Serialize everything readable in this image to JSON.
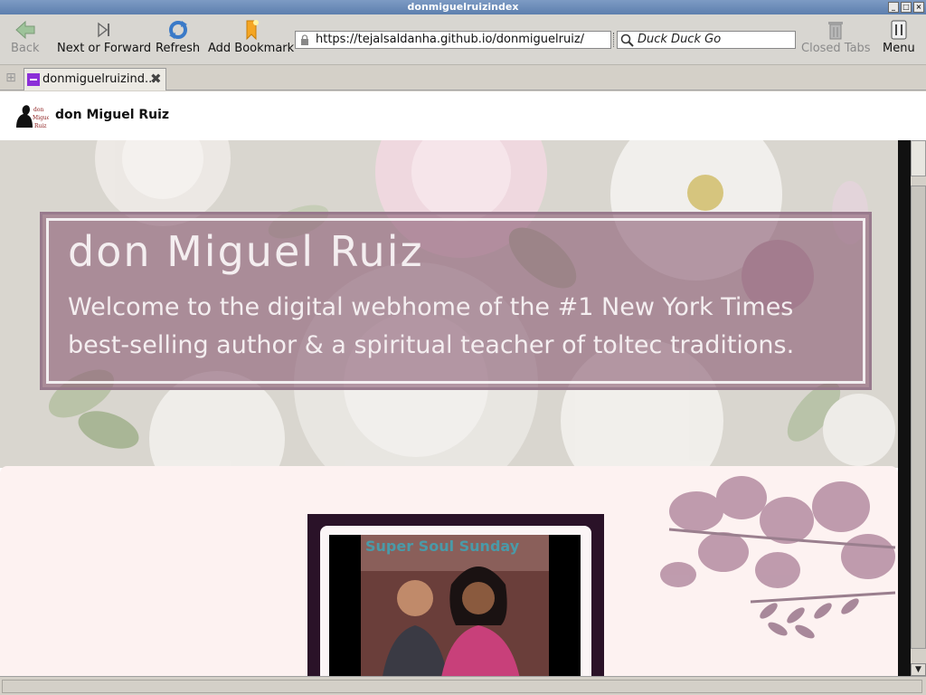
{
  "window": {
    "title": "donmiguelruizindex"
  },
  "toolbar": {
    "back_label": "Back",
    "forward_label": "Next or Forward",
    "refresh_label": "Refresh",
    "bookmark_label": "Add Bookmark",
    "closed_tabs_label": "Closed Tabs",
    "menu_label": "Menu"
  },
  "address": {
    "url": "https://tejalsaldanha.github.io/donmiguelruiz/"
  },
  "search": {
    "placeholder": "Duck Duck Go"
  },
  "tabs": [
    {
      "label": "donmiguelruizind..."
    }
  ],
  "page": {
    "brand": "don Miguel Ruiz",
    "hero_title": "don Miguel Ruiz",
    "hero_subtitle": "Welcome to the digital webhome of the #1 New York Times best-selling author & a spiritual teacher of toltec traditions.",
    "photo_text": "Super Soul Sunday"
  },
  "colors": {
    "hero_overlay": "#8c5f76",
    "section_bg": "#fdf2f1",
    "frame": "#2a1228",
    "tab_favicon": "#8b2fd8"
  }
}
